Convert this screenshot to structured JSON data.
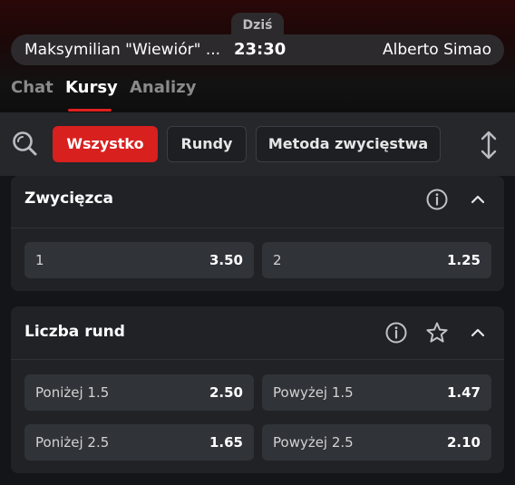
{
  "header": {
    "date_label": "Dziś",
    "home_team": "Maksymilian \"Wiewiór\" ...",
    "time": "23:30",
    "away_team": "Alberto Simao"
  },
  "tabs": [
    {
      "label": "Chat",
      "active": false
    },
    {
      "label": "Kursy",
      "active": true
    },
    {
      "label": "Analizy",
      "active": false
    }
  ],
  "filters": {
    "search_icon": "search-icon",
    "chips": [
      {
        "label": "Wszystko",
        "active": true
      },
      {
        "label": "Rundy",
        "active": false
      },
      {
        "label": "Metoda zwycięstwa",
        "active": false
      }
    ],
    "sort_icon": "sort-arrows-icon"
  },
  "markets": [
    {
      "title": "Zwycięzca",
      "icons": [
        "info-icon",
        "chevron-up-icon"
      ],
      "odds": [
        {
          "label": "1",
          "value": "3.50"
        },
        {
          "label": "2",
          "value": "1.25"
        }
      ]
    },
    {
      "title": "Liczba rund",
      "icons": [
        "info-icon",
        "star-icon",
        "chevron-up-icon"
      ],
      "odds": [
        {
          "label": "Poniżej 1.5",
          "value": "2.50"
        },
        {
          "label": "Powyżej 1.5",
          "value": "1.47"
        },
        {
          "label": "Poniżej 2.5",
          "value": "1.65"
        },
        {
          "label": "Powyżej 2.5",
          "value": "2.10"
        }
      ]
    }
  ],
  "colors": {
    "accent": "#d8201f",
    "background": "#131518",
    "card": "#202226",
    "odd_button": "#303338"
  }
}
